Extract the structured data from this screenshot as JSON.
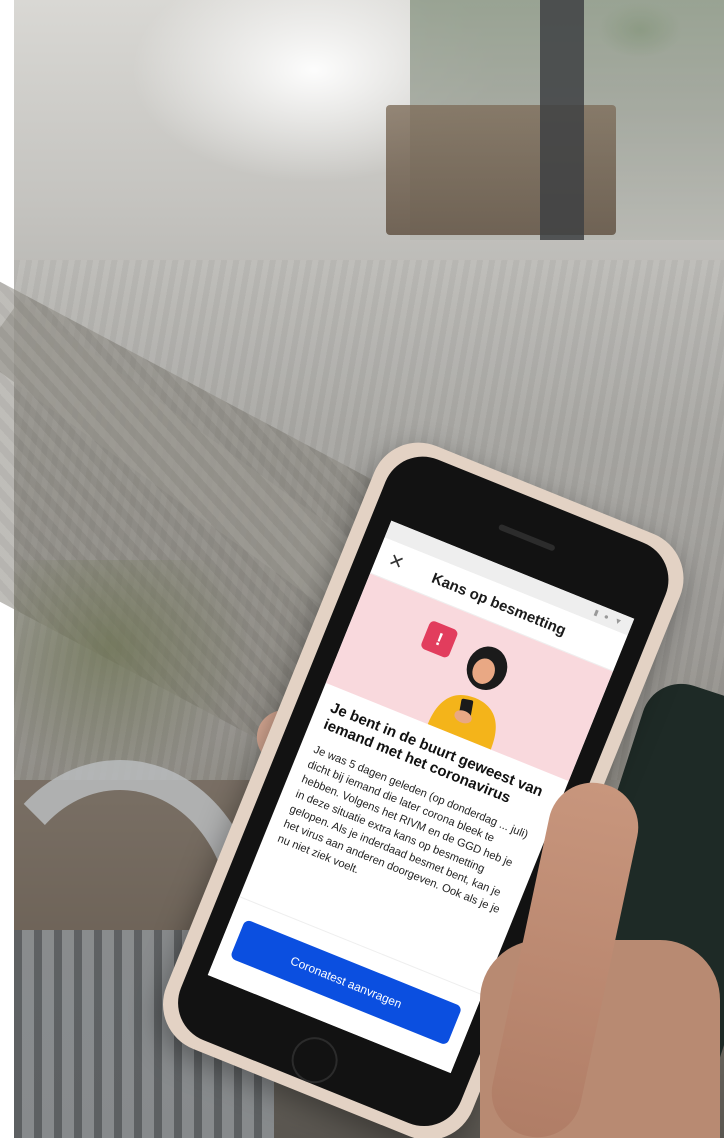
{
  "screen": {
    "title": "Kans op besmetting",
    "close_icon": "close-icon",
    "status_icons": "▮ ● ▼",
    "hero": {
      "warning_icon": "warning-icon",
      "warning_glyph": "!",
      "accent_color": "#e23d5d",
      "background_color": "#f9d9dd"
    },
    "headline": "Je bent in de buurt geweest van iemand met het coronavirus",
    "body": "Je was 5 dagen geleden (op donderdag ... juli) dicht bij iemand die later corona bleek te hebben. Volgens het RIVM en de GGD heb je in deze situatie extra kans op besmetting gelopen. Als je inderdaad besmet bent, kan je het virus aan anderen doorgeven. Ook als je je nu niet ziek voelt.",
    "cta_label": "Coronatest aanvragen",
    "cta_color": "#0b4fe0"
  }
}
